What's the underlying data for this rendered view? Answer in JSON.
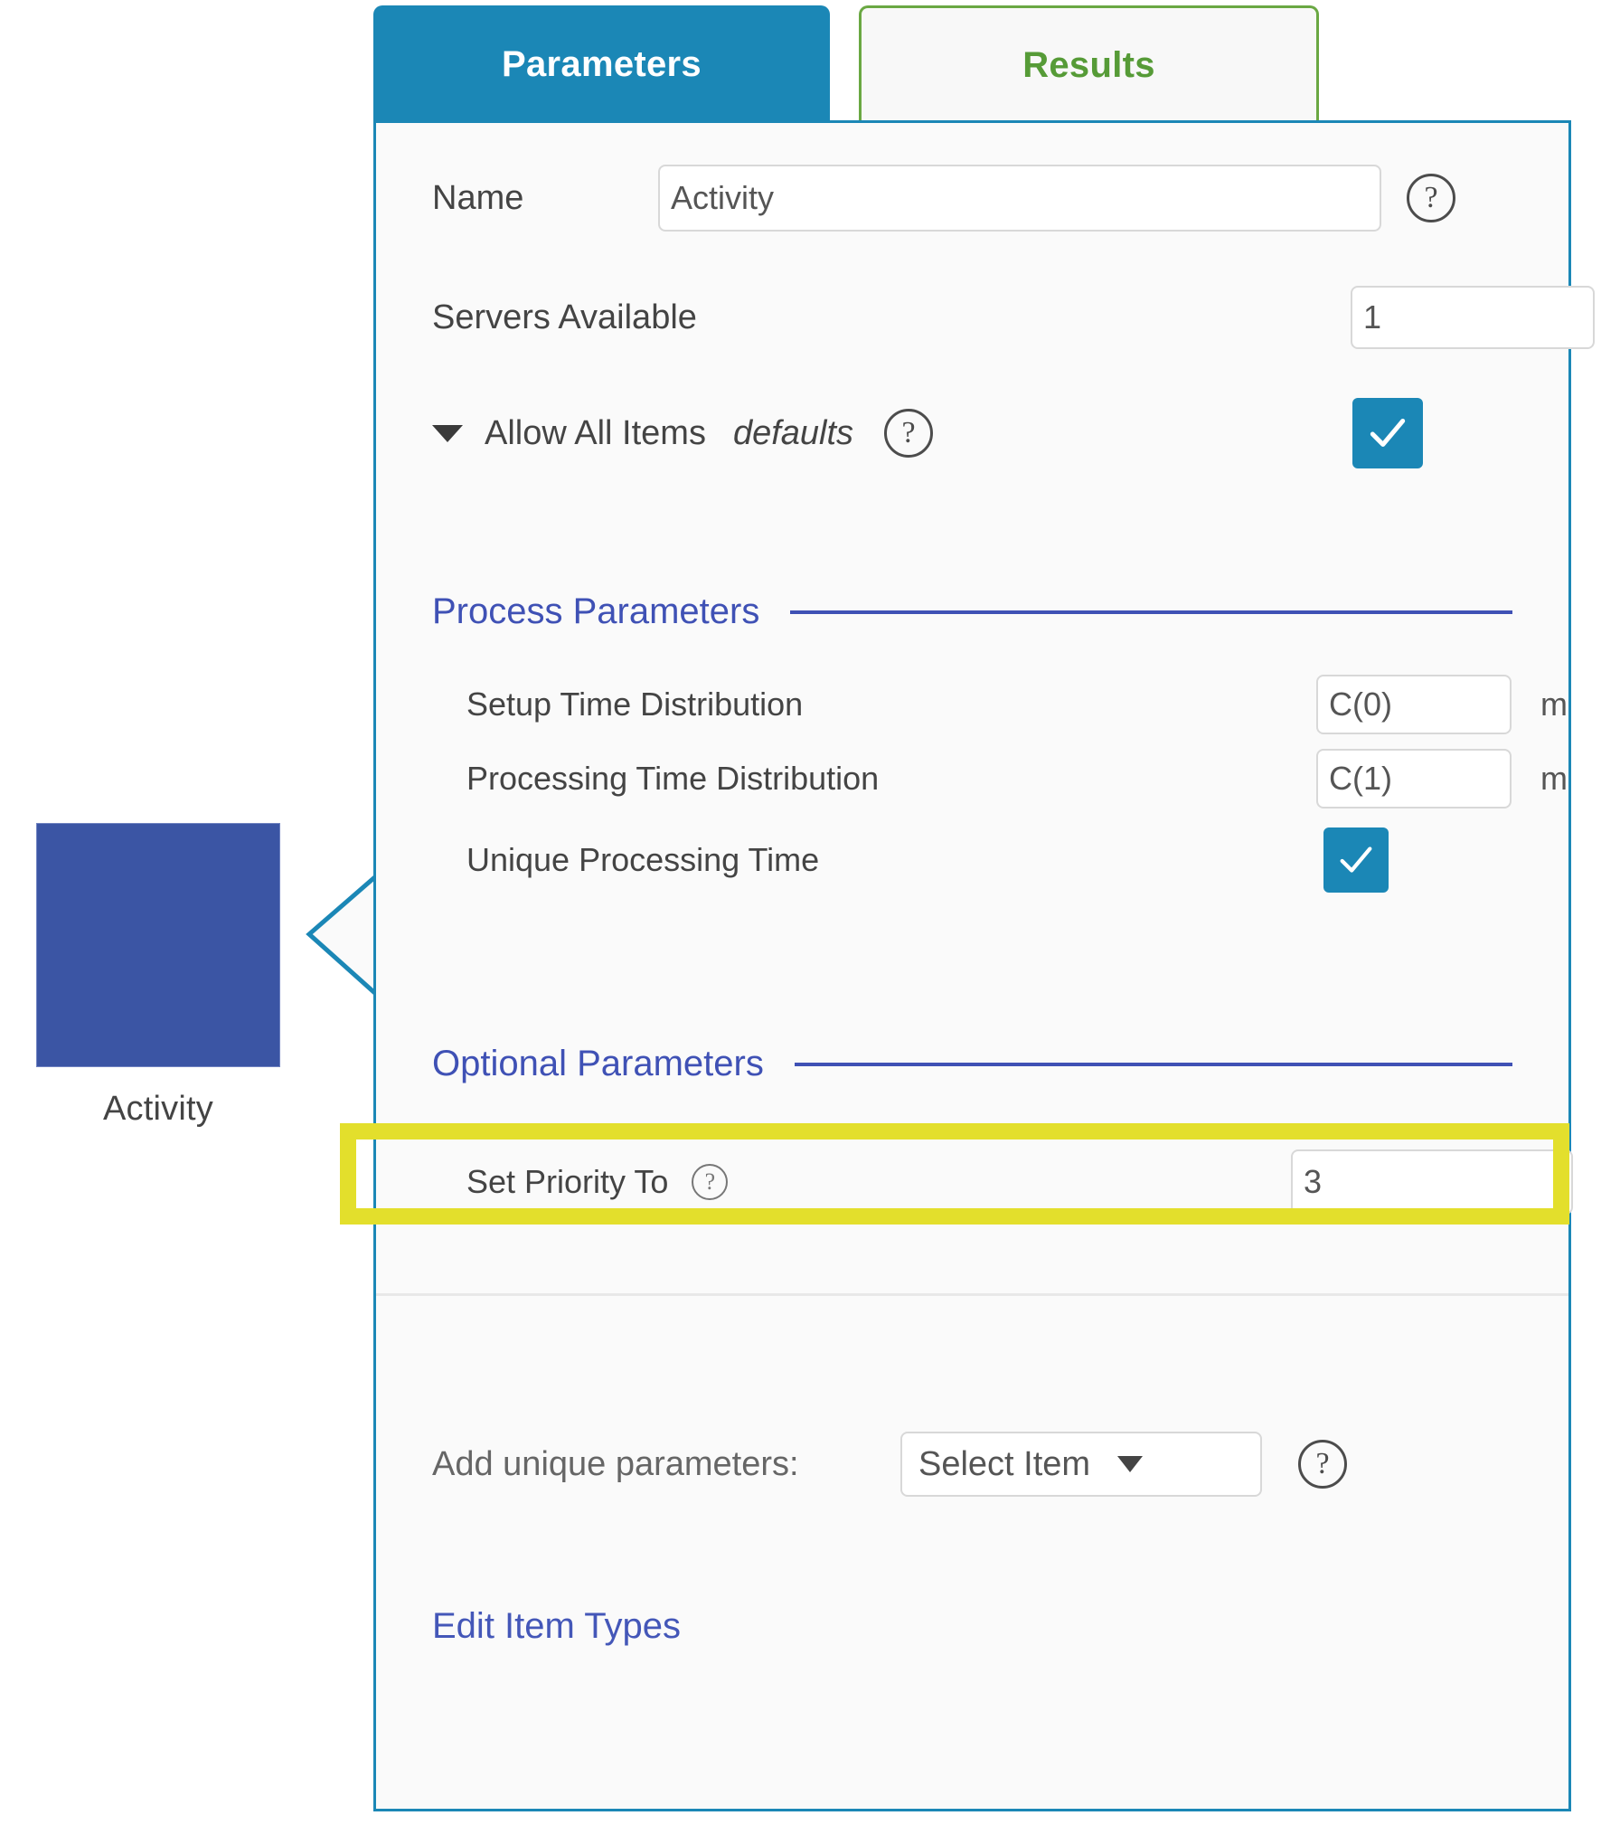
{
  "node": {
    "label": "Activity",
    "color": "#3b55a4"
  },
  "tabs": [
    {
      "label": "Parameters",
      "active": true,
      "color": "#1b87b6"
    },
    {
      "label": "Results",
      "active": false,
      "color": "#6aa843"
    }
  ],
  "panel": {
    "name_row": {
      "label": "Name",
      "value": "Activity",
      "help": "?"
    },
    "servers_row": {
      "label": "Servers Available",
      "value": "1"
    },
    "allow_all_items": {
      "label": "Allow All Items",
      "sublabel": "defaults",
      "help": "?",
      "checked": true
    },
    "process_parameters": {
      "title": "Process Parameters",
      "rows": [
        {
          "label": "Setup Time Distribution",
          "value": "C(0)",
          "unit": "m",
          "type": "text"
        },
        {
          "label": "Processing Time Distribution",
          "value": "C(1)",
          "unit": "m",
          "type": "text"
        },
        {
          "label": "Unique Processing Time",
          "value": "",
          "unit": "",
          "type": "checkbox",
          "checked": true
        }
      ]
    },
    "optional_parameters": {
      "title": "Optional Parameters",
      "rows": [
        {
          "label": "Set Priority To",
          "help": "?",
          "value": "3",
          "highlighted": true
        }
      ]
    },
    "footer": {
      "add_unique_label": "Add unique parameters:",
      "select_value": "Select Item",
      "select_caret": "▼",
      "help": "?",
      "edit_link": "Edit Item Types"
    }
  },
  "highlight": {
    "color": "#e3df2c"
  }
}
